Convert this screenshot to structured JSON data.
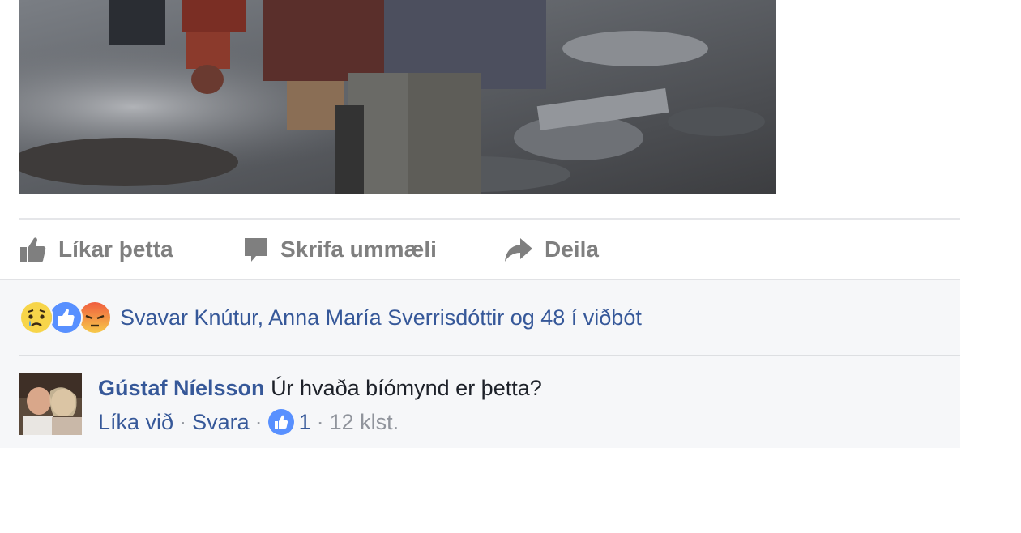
{
  "actions": {
    "like_label": "Líkar þetta",
    "comment_label": "Skrifa ummæli",
    "share_label": "Deila"
  },
  "reactions": {
    "icons": [
      "sad",
      "like",
      "angry"
    ],
    "summary": "Svavar Knútur, Anna María Sverrisdóttir og 48 í viðbót"
  },
  "comment": {
    "author": "Gústaf Níelsson",
    "text": "Úr hvaða bíómynd er þetta?",
    "like_link": "Líka við",
    "reply_link": "Svara",
    "separator": "·",
    "like_count": "1",
    "time": "12 klst."
  },
  "colors": {
    "link": "#365899",
    "muted": "#7f7f7f",
    "feedback_bg": "#f6f7f9",
    "like_blue": "#5890ff",
    "angry_red": "#f05d3f",
    "sad_yellow": "#f7d54a"
  }
}
